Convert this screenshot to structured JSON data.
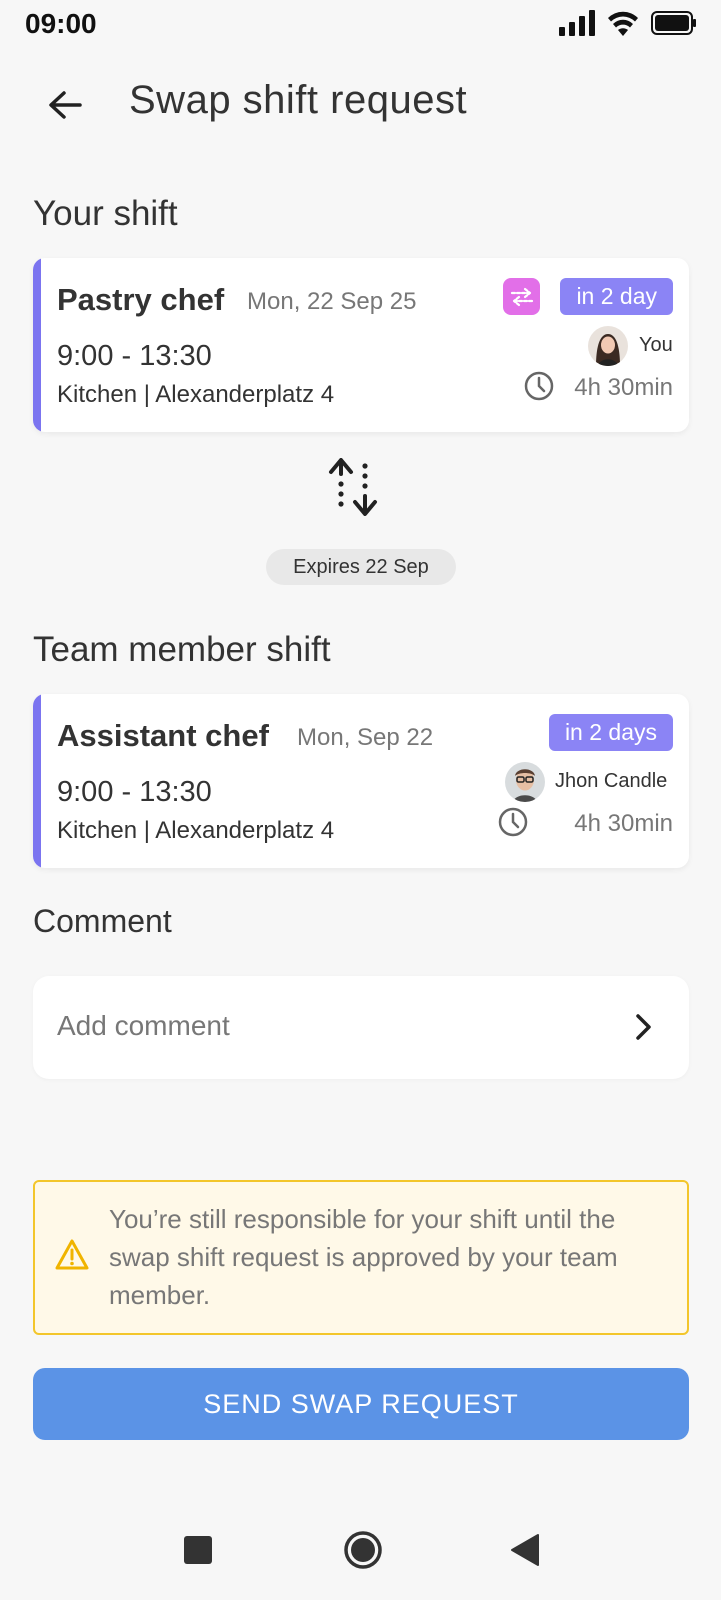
{
  "status_bar": {
    "time": "09:00",
    "icons": [
      "signal-icon",
      "wifi-icon",
      "battery-icon"
    ]
  },
  "header": {
    "title": "Swap shift request",
    "back_icon": "arrow-left-icon"
  },
  "your_shift": {
    "section_title": "Your shift",
    "role": "Pastry chef",
    "date": "Mon, 22 Sep 25",
    "time": "9:00 - 13:30",
    "location": "Kitchen | Alexanderplatz 4",
    "badge": "in 2 day",
    "person": "You",
    "duration": "4h 30min",
    "swap_icon": "swap-icon",
    "accent_color": "#7b74f0"
  },
  "swap_arrows_icon": "swap-vertical-icon",
  "expires": "Expires 22 Sep",
  "team_member_shift": {
    "section_title": "Team member shift",
    "role": "Assistant chef",
    "date": "Mon, Sep 22",
    "time": "9:00 - 13:30",
    "location": "Kitchen | Alexanderplatz 4",
    "badge": "in 2 days",
    "person": "Jhon Candle",
    "duration": "4h 30min",
    "accent_color": "#7b74f0"
  },
  "comment": {
    "section_title": "Comment",
    "placeholder": "Add comment"
  },
  "warning": {
    "text": "You’re still responsible for your shift until the swap shift request is approved by your team member.",
    "icon": "warning-icon"
  },
  "send_button": {
    "label": "SEND SWAP REQUEST",
    "color": "#5b93e6"
  },
  "nav": {
    "icons": [
      "recents-icon",
      "home-icon",
      "back-icon"
    ]
  }
}
